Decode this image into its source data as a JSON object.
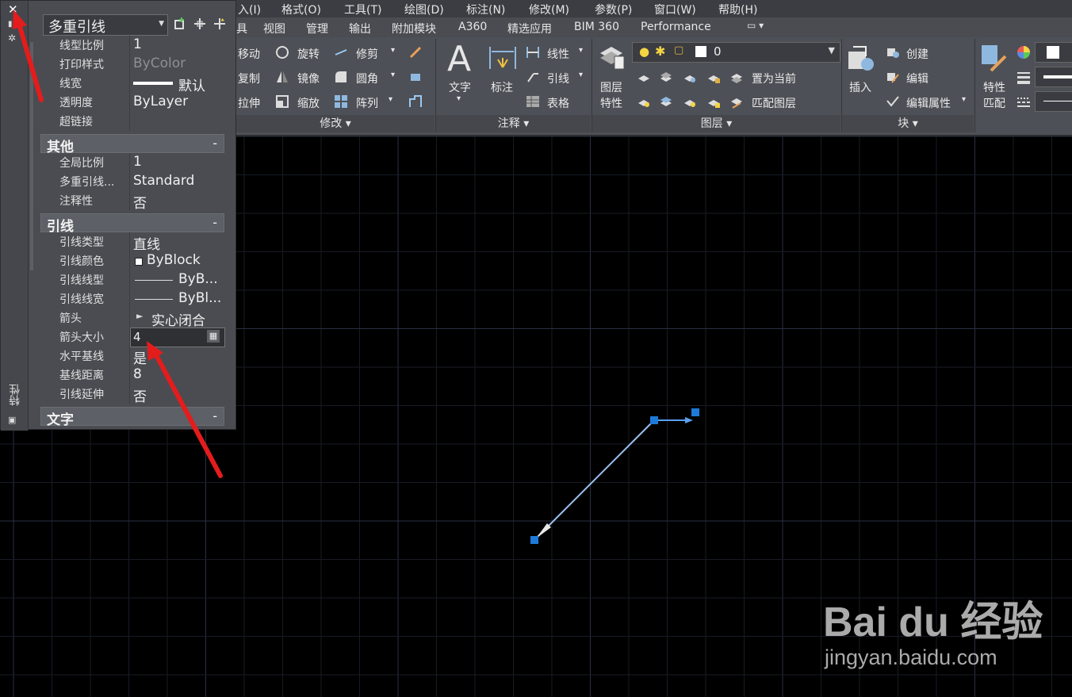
{
  "menubar": {
    "items": [
      "入(I)",
      "格式(O)",
      "工具(T)",
      "绘图(D)",
      "标注(N)",
      "修改(M)",
      "参数(P)",
      "窗口(W)",
      "帮助(H)"
    ]
  },
  "tabs": [
    "具",
    "视图",
    "管理",
    "输出",
    "附加模块",
    "A360",
    "精选应用",
    "BIM 360",
    "Performance"
  ],
  "ribbon": {
    "modify": {
      "title": "修改 ▾",
      "move": "移动",
      "rotate": "旋转",
      "trim": "修剪",
      "copy": "复制",
      "mirror": "镜像",
      "fillet": "圆角",
      "stretch": "拉伸",
      "scale": "缩放",
      "array": "阵列"
    },
    "annotation": {
      "title": "注释 ▾",
      "text": "文字",
      "dimension": "标注",
      "linear": "线性",
      "leader": "引线",
      "table": "表格"
    },
    "layers": {
      "title": "图层 ▾",
      "layer_props_1": "图层",
      "layer_props_2": "特性",
      "current_layer": "0",
      "set_current": "置为当前",
      "match_layer": "匹配图层"
    },
    "block": {
      "title": "块 ▾",
      "insert": "插入",
      "create": "创建",
      "edit": "编辑",
      "edit_attr": "编辑属性"
    },
    "properties": {
      "match_1": "特性",
      "match_2": "匹配"
    }
  },
  "palette": {
    "object_type": "多重引线",
    "side_title": "特性",
    "rows_top": [
      {
        "label": "线型比例",
        "value": "1"
      },
      {
        "label": "打印样式",
        "value": "ByColor"
      },
      {
        "label": "线宽",
        "value": "默认"
      },
      {
        "label": "透明度",
        "value": "ByLayer"
      },
      {
        "label": "超链接",
        "value": ""
      }
    ],
    "section_other": "其他",
    "rows_other": [
      {
        "label": "全局比例",
        "value": "1"
      },
      {
        "label": "多重引线...",
        "value": "Standard"
      },
      {
        "label": "注释性",
        "value": "否"
      }
    ],
    "section_leader": "引线",
    "rows_leader": [
      {
        "label": "引线类型",
        "value": "直线"
      },
      {
        "label": "引线颜色",
        "value": "ByBlock"
      },
      {
        "label": "引线线型",
        "value": "ByB..."
      },
      {
        "label": "引线线宽",
        "value": "ByBl..."
      },
      {
        "label": "箭头",
        "value": "实心闭合"
      },
      {
        "label": "箭头大小",
        "value": "4"
      },
      {
        "label": "水平基线",
        "value": "是"
      },
      {
        "label": "基线距离",
        "value": "8"
      },
      {
        "label": "引线延伸",
        "value": "否"
      }
    ],
    "section_text": "文字",
    "collapse_symbol": "-"
  },
  "watermark": {
    "brand": "Bai du 经验",
    "url": "jingyan.baidu.com"
  },
  "colors": {
    "accent_grip": "#1e7ad8",
    "annotation_arrow": "#e41c1c"
  }
}
